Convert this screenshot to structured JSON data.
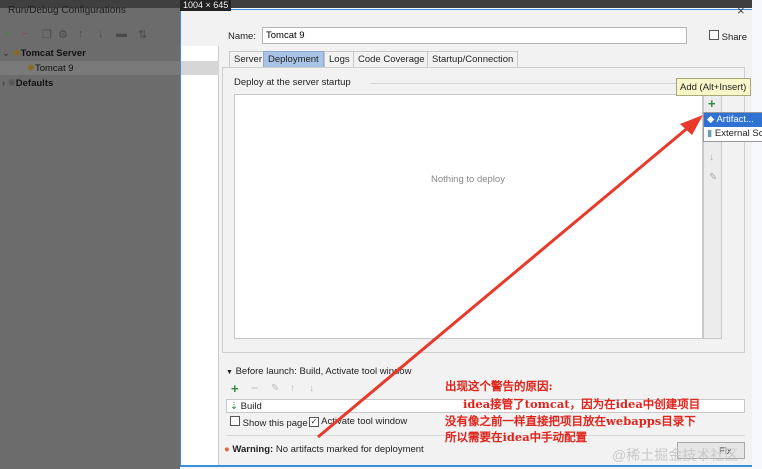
{
  "screen_size_label": "1004 × 645",
  "left_panel": {
    "title": "Run/Debug Configurations",
    "toolbar": [
      "add-icon",
      "remove-icon",
      "copy-icon",
      "wrench-icon",
      "up-icon",
      "down-icon",
      "folder-icon",
      "sort-icon"
    ],
    "tree": [
      {
        "label": "Tomcat Server",
        "bold": true
      },
      {
        "label": "Tomcat 9",
        "selected": true
      },
      {
        "label": "Defaults",
        "bold": true
      }
    ]
  },
  "dialog": {
    "name_label": "Name:",
    "name_value": "Tomcat 9",
    "share_label": "Share",
    "tabs": [
      "Server",
      "Deployment",
      "Logs",
      "Code Coverage",
      "Startup/Connection"
    ],
    "active_tab": "Deployment",
    "deploy_label": "Deploy at the server startup",
    "empty_text": "Nothing to deploy",
    "tooltip": "Add (Alt+Insert)",
    "popup": [
      "Artifact...",
      "External So"
    ],
    "before_launch": "Before launch: Build, Activate tool window",
    "build_item": "Build",
    "show_page": "Show this page",
    "activate_tool": "Activate tool window",
    "warning_bold": "Warning:",
    "warning_text": "No artifacts marked for deployment",
    "fix_label": "Fix"
  },
  "annotation": [
    "出现这个警告的原因:",
    "idea接管了tomcat，因为在idea中创建项目",
    "没有像之前一样直接把项目放在webapps目录下",
    "所以需要在idea中手动配置"
  ],
  "watermark": "@稀土掘金技术社区",
  "colors": {
    "annotation": "#e0231b",
    "selection": "#2f72d4",
    "tab_selected": "#a9c3e6"
  }
}
